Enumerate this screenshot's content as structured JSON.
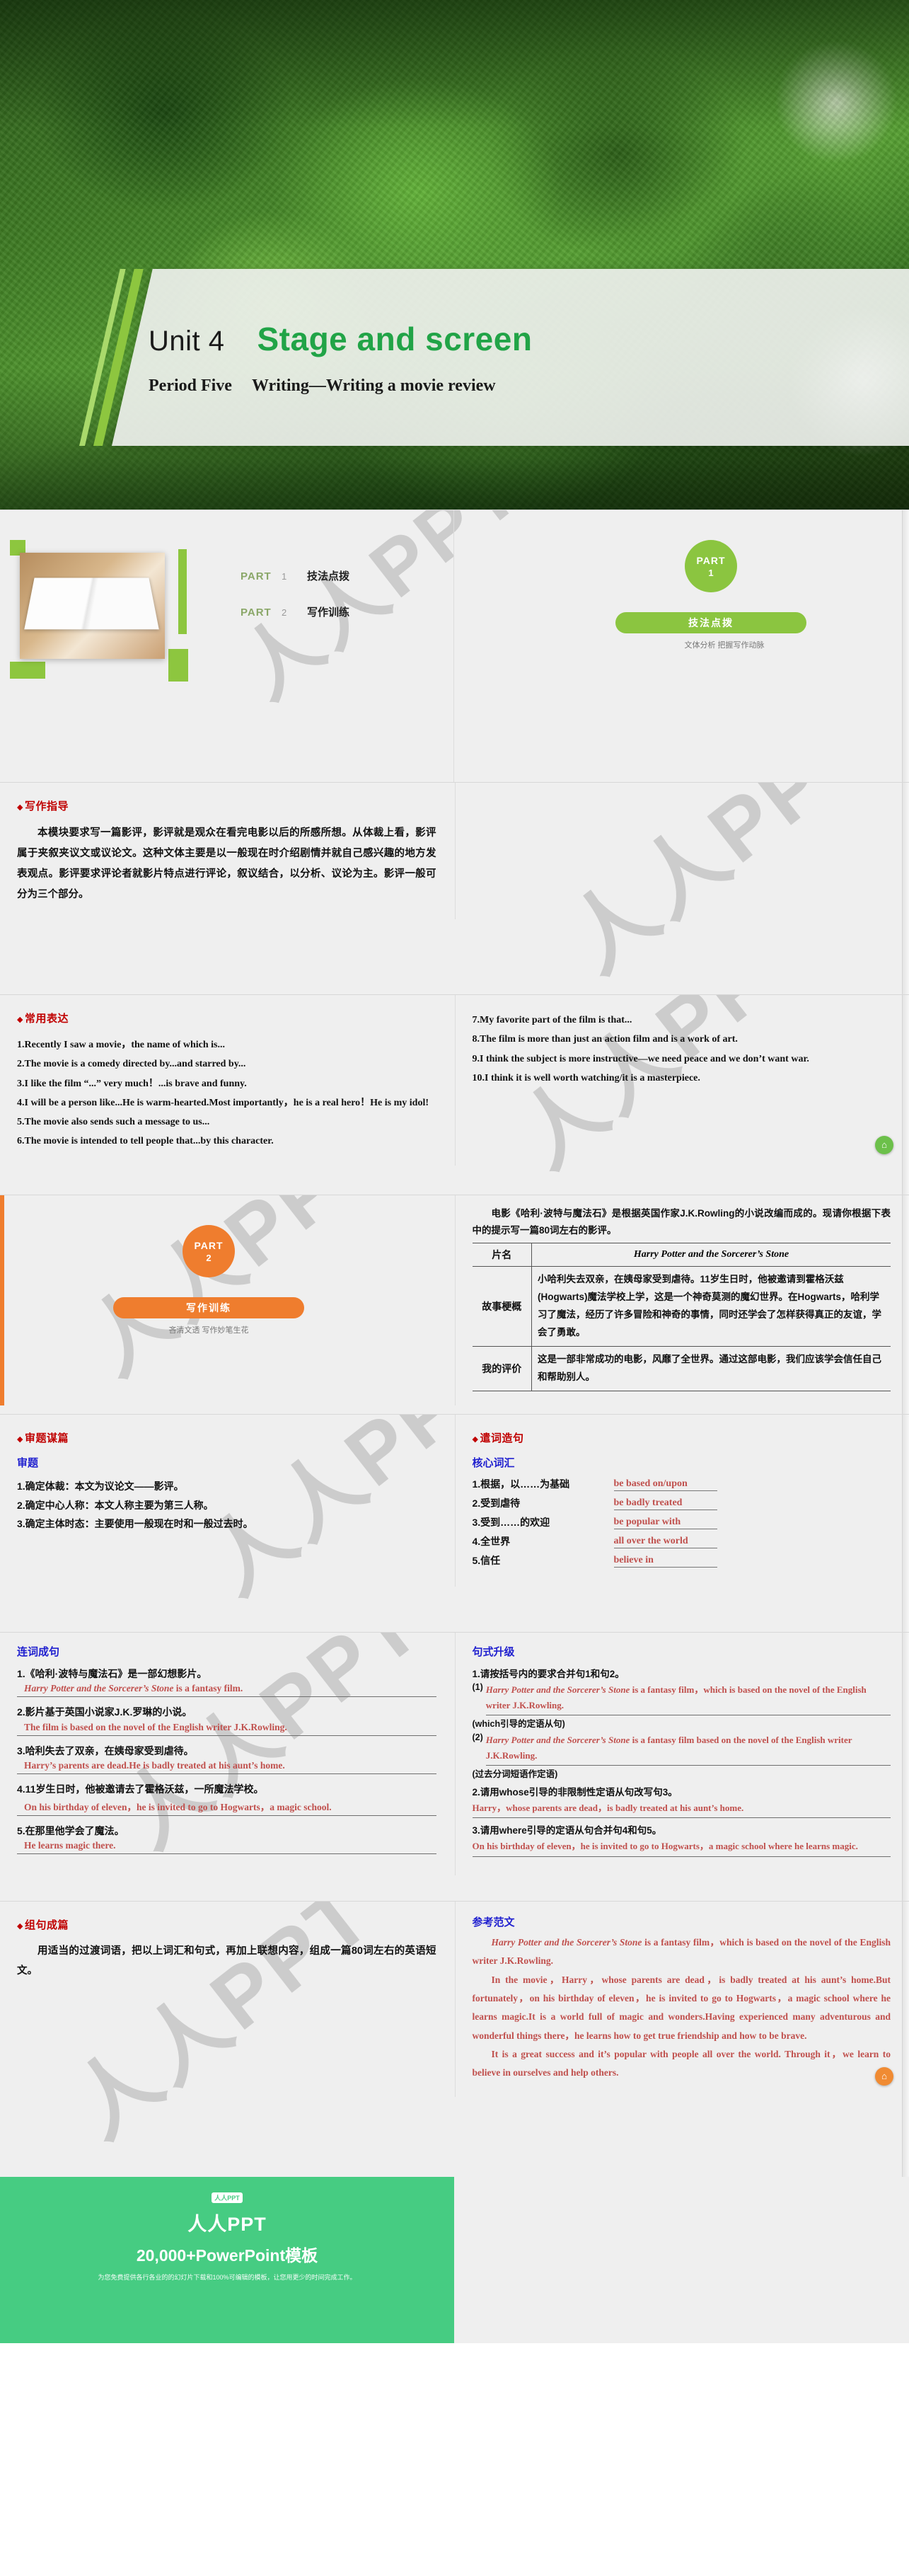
{
  "title_slide": {
    "unit_no": "Unit 4",
    "unit_name": "Stage and screen",
    "period": "Period Five",
    "period_sub": "Writing—Writing a movie review"
  },
  "overview": {
    "items": [
      {
        "part": "PART",
        "num": "1",
        "label": "技法点拨"
      },
      {
        "part": "PART",
        "num": "2",
        "label": "写作训练"
      }
    ],
    "part_badge": {
      "line1": "PART",
      "line2": "1"
    },
    "pill_label": "技法点拨",
    "sub_label": "文体分析  把握写作动脉"
  },
  "guide": {
    "heading": "写作指导",
    "body": "本模块要求写一篇影评，影评就是观众在看完电影以后的所感所想。从体裁上看，影评属于夹叙夹议文或议论文。这种文体主要是以一般现在时介绍剧情并就自己感兴趣的地方发表观点。影评要求评论者就影片特点进行评论，叙议结合，以分析、议论为主。影评一般可分为三个部分。"
  },
  "expressions": {
    "heading": "常用表达",
    "left": [
      "1.Recently I saw a movie，the name of which is...",
      "2.The movie is a comedy directed by...and starred by...",
      "3.I like the film “...” very much！...is brave and funny.",
      "4.I will be a person like...He is warm-hearted.Most importantly，he is a real hero！He is my idol!",
      "5.The movie also sends such a message to us...",
      "6.The movie is intended to tell people that...by this character."
    ],
    "right": [
      "7.My favorite part of the film is that...",
      "8.The film is more than just an action film and is a work of art.",
      "9.I think the subject is more instructive—we need peace and we don’t want war.",
      "10.I think it is well worth watching/it is a masterpiece."
    ]
  },
  "part2": {
    "badge_line1": "PART",
    "badge_line2": "2",
    "pill_label": "写作训练",
    "sub_label": "吝清文透  写作妙笔生花"
  },
  "prompt": {
    "intro": "电影《哈利·波特与魔法石》是根据英国作家J.K.Rowling的小说改编而成的。现请你根据下表中的提示写一篇80词左右的影评。",
    "rows": [
      {
        "label": "片名",
        "value": "Harry Potter and the Sorcerer’s Stone",
        "italic": true
      },
      {
        "label": "故事梗概",
        "value": "小哈利失去双亲，在姨母家受到虐待。11岁生日时，他被邀请到霍格沃兹(Hogwarts)魔法学校上学，这是一个神奇莫测的魔幻世界。在Hogwarts，哈利学习了魔法，经历了许多冒险和神奇的事情，同时还学会了怎样获得真正的友谊，学会了勇敢。",
        "italic": false
      },
      {
        "label": "我的评价",
        "value": "这是一部非常成功的电影，风靡了全世界。通过这部电影，我们应该学会信任自己和帮助别人。",
        "italic": false
      }
    ]
  },
  "analysis": {
    "heading": "审题谋篇",
    "sub_heading": "审题",
    "items": [
      "1.确定体裁：本文为议论文——影评。",
      "2.确定中心人称：本文人称主要为第三人称。",
      "3.确定主体时态：主要使用一般现在时和一般过去时。"
    ]
  },
  "wording": {
    "heading": "遣词造句",
    "sub_heading": "核心词汇",
    "rows": [
      {
        "cn": "1.根据，以……为基础",
        "en": "be based on/upon"
      },
      {
        "cn": "2.受到虐待",
        "en": "be badly treated"
      },
      {
        "cn": "3.受到……的欢迎",
        "en": "be popular with"
      },
      {
        "cn": "4.全世界",
        "en": "all over the world"
      },
      {
        "cn": "5.信任",
        "en": "believe in"
      }
    ]
  },
  "sentences": {
    "heading": "连词成句",
    "items": [
      {
        "cn": "1.《哈利·波特与魔法石》是一部幻想影片。",
        "en_italic": "Harry Potter and the Sorcerer’s Stone",
        "en_rest": " is a fantasy film."
      },
      {
        "cn": "2.影片基于英国小说家J.K.罗琳的小说。",
        "en_italic": "",
        "en_rest": "The film is based on the novel of the English writer J.K.Rowling."
      },
      {
        "cn": "3.哈利失去了双亲，在姨母家受到虐待。",
        "en_italic": "",
        "en_rest": "Harry’s parents are dead.He is badly treated at his aunt’s home."
      },
      {
        "cn": "4.11岁生日时，他被邀请去了霍格沃兹，一所魔法学校。",
        "en_italic": "",
        "en_rest": "On his birthday of eleven，he is invited to go to Hogwarts，a magic school."
      },
      {
        "cn": "5.在那里他学会了魔法。",
        "en_italic": "",
        "en_rest": "He learns magic there."
      }
    ]
  },
  "upgrade": {
    "heading": "句式升级",
    "q1": "1.请按括号内的要求合并句1和句2。",
    "a1_label": "(1)",
    "a1_italic": "Harry Potter and the Sorcerer’s Stone",
    "a1_rest": " is a fantasy film，which is based on the novel of the English writer J.K.Rowling.",
    "a1_tag": "(which引导的定语从句)",
    "a2_label": "(2)",
    "a2_italic": "Harry Potter and the Sorcerer’s Stone",
    "a2_rest": " is a fantasy film based on the novel of the English writer J.K.Rowling.",
    "a2_tag": "(过去分词短语作定语)",
    "q2": "2.请用whose引导的非限制性定语从句改写句3。",
    "a3": "Harry，whose parents are dead，is badly treated at his aunt’s home.",
    "q3": "3.请用where引导的定语从句合并句4和句5。",
    "a4": "On his birthday of eleven，he is invited to go to Hogwarts，a magic school where he learns magic."
  },
  "composition": {
    "heading": "组句成篇",
    "body": "用适当的过渡词语，把以上词汇和句式，再加上联想内容，组成一篇80词左右的英语短文。"
  },
  "model": {
    "heading": "参考范文",
    "p1_italic": "Harry Potter and the Sorcerer’s Stone",
    "p1_rest": " is a fantasy film，which is based on the novel of the English writer J.K.Rowling.",
    "p2": "In the movie，Harry，whose parents are dead，is badly treated at his aunt’s home.But fortunately，on his birthday of eleven，he is invited to go to Hogwarts，a magic school where he learns magic.It is a world full of magic and wonders.Having experienced many adventurous and wonderful things there，he learns how to get true friendship and how to be brave.",
    "p3": "It is a great success and it’s popular with people all over the world. Through it，we learn to believe in ourselves and help others."
  },
  "footer": {
    "logo_text": "人人PPT",
    "brand": "人人PPT",
    "tagline": "20,000+PowerPoint模板",
    "note": "为您免费提供各行各业的的幻灯片下载和100%可编辑的模板，让您用更少的时间完成工作。"
  },
  "icons": {
    "home": "⌂",
    "diamond": "◆"
  },
  "colors": {
    "green": "#8bc540",
    "orange": "#ef7d2e",
    "red_heading": "#c00000",
    "blue_heading": "#2020cf",
    "answer": "#c0504d",
    "brand_green": "#46cc82",
    "title_green": "#21a447"
  }
}
